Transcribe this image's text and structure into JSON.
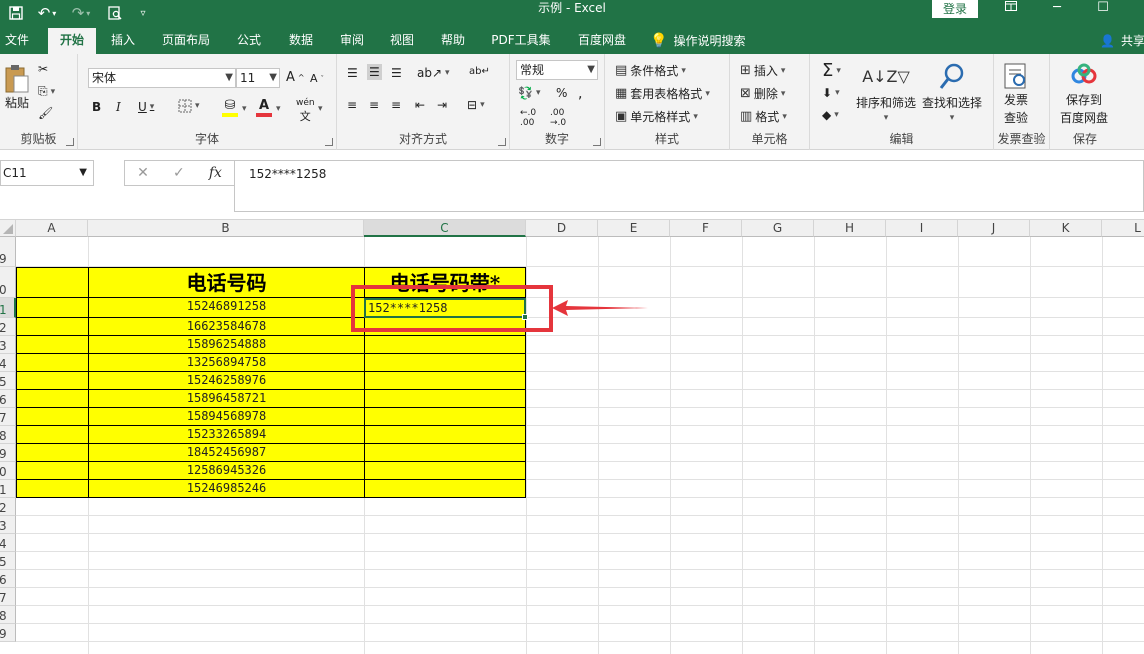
{
  "titlebar": {
    "title": "示例 - Excel",
    "login": "登录",
    "icons": [
      "save-icon",
      "undo-icon",
      "redo-icon",
      "print-preview-icon",
      "customize-qat-icon"
    ]
  },
  "tabs": [
    "文件",
    "开始",
    "插入",
    "页面布局",
    "公式",
    "数据",
    "审阅",
    "视图",
    "帮助",
    "PDF工具集",
    "百度网盘"
  ],
  "tell_me": "操作说明搜索",
  "share": "共享",
  "ribbon": {
    "clipboard": {
      "label": "剪贴板",
      "paste": "粘贴"
    },
    "font": {
      "label": "字体",
      "name": "宋体",
      "size": "11",
      "phonetic": "wén"
    },
    "alignment": {
      "label": "对齐方式"
    },
    "number": {
      "label": "数字",
      "format": "常规"
    },
    "styles": {
      "label": "样式",
      "conditional": "条件格式",
      "table": "套用表格格式",
      "cell_styles": "单元格样式"
    },
    "cells": {
      "label": "单元格",
      "insert": "插入",
      "delete": "删除",
      "format": "格式"
    },
    "editing": {
      "label": "编辑",
      "sort": "排序和筛选",
      "find": "查找和选择"
    },
    "invoice": {
      "label": "发票查验",
      "btn_line1": "发票",
      "btn_line2": "查验"
    },
    "save": {
      "label": "保存",
      "btn_line1": "保存到",
      "btn_line2": "百度网盘"
    }
  },
  "formula_bar": {
    "name_box": "C11",
    "content": "152****1258"
  },
  "columns": [
    "A",
    "B",
    "C",
    "D",
    "E",
    "F",
    "G",
    "H",
    "I",
    "J",
    "K",
    "L"
  ],
  "row_labels": [
    "9",
    "0",
    "1",
    "2",
    "3",
    "4",
    "5",
    "6",
    "7",
    "8",
    "9",
    "0",
    "1",
    "2",
    "3",
    "4",
    "5",
    "6",
    "7",
    "8",
    "9"
  ],
  "sheet": {
    "header_b": "电话号码",
    "header_c": "电话号码带*",
    "phones": [
      "15246891258",
      "16623584678",
      "15896254888",
      "13256894758",
      "15246258976",
      "15896458721",
      "15894568978",
      "15233265894",
      "18452456987",
      "12586945326",
      "15246985246"
    ],
    "active_value": "152****1258"
  },
  "colors": {
    "excel_green": "#217346",
    "highlight": "#ffff00",
    "annotation_red": "#e5353c"
  }
}
